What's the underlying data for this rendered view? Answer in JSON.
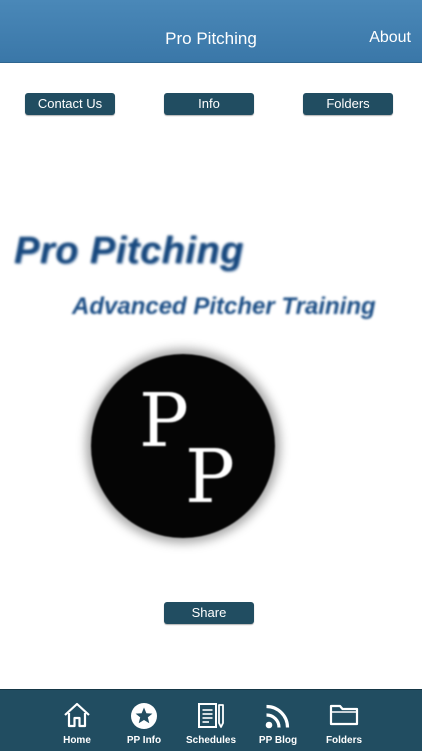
{
  "header": {
    "title": "Pro Pitching",
    "about_label": "About"
  },
  "actions": {
    "contact_label": "Contact Us",
    "info_label": "Info",
    "folders_label": "Folders",
    "share_label": "Share"
  },
  "branding": {
    "title": "Pro Pitching",
    "subtitle": "Advanced Pitcher Training",
    "logo_letters": "PP"
  },
  "tabbar": {
    "items": [
      {
        "label": "Home",
        "icon": "home-icon"
      },
      {
        "label": "PP Info",
        "icon": "star-circle-icon"
      },
      {
        "label": "Schedules",
        "icon": "document-pencil-icon"
      },
      {
        "label": "PP Blog",
        "icon": "rss-icon"
      },
      {
        "label": "Folders",
        "icon": "folder-icon"
      }
    ]
  },
  "colors": {
    "navbar": "#3f7fb0",
    "button": "#214d61",
    "tabbar": "#214d61",
    "brand_text": "#17487e"
  }
}
